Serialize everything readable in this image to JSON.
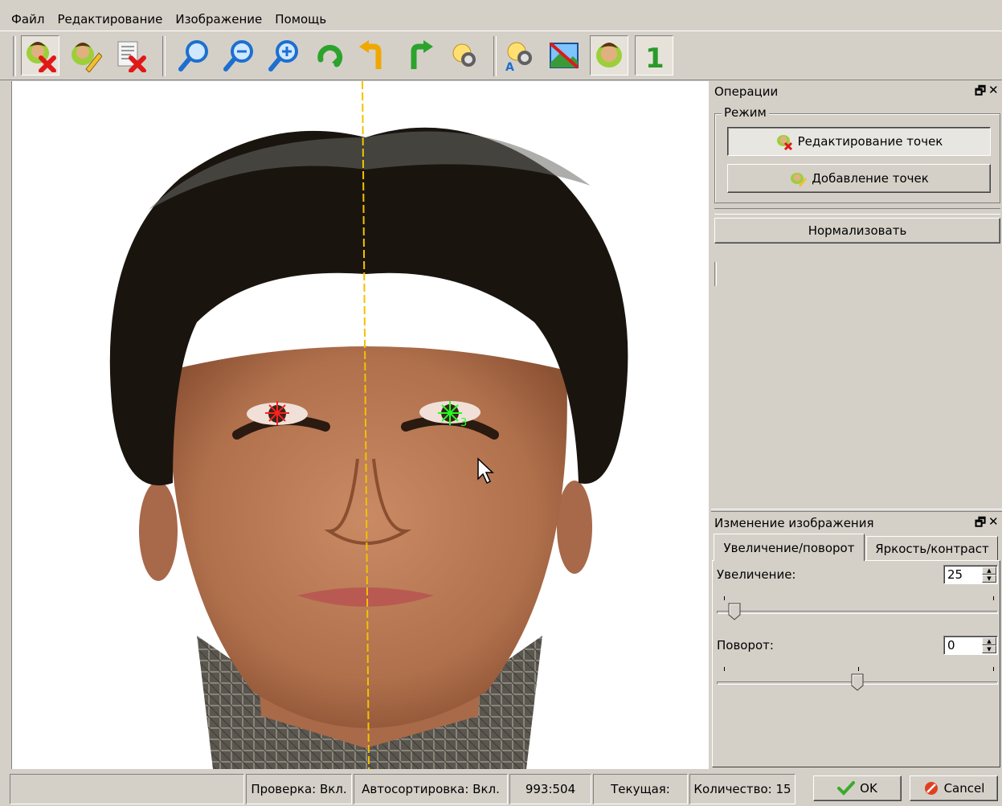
{
  "menu": [
    "Файл",
    "Редактирование",
    "Изображение",
    "Помощь"
  ],
  "toolbar": {
    "buttons": [
      {
        "icon": "delete-person-icon",
        "pressed": true
      },
      {
        "icon": "edit-person-icon",
        "pressed": false
      },
      {
        "icon": "delete-document-icon",
        "pressed": false
      },
      {
        "icon": "zoom-icon",
        "pressed": false
      },
      {
        "icon": "zoom-out-icon",
        "pressed": false
      },
      {
        "icon": "zoom-in-icon",
        "pressed": false
      },
      {
        "icon": "rotate-icon",
        "pressed": false
      },
      {
        "icon": "undo-icon",
        "pressed": false
      },
      {
        "icon": "redo-icon",
        "pressed": false
      },
      {
        "icon": "brightness-icon",
        "pressed": false
      },
      {
        "icon": "auto-brightness-icon",
        "pressed": false
      },
      {
        "icon": "hide-image-icon",
        "pressed": false
      },
      {
        "icon": "face-points-icon",
        "pressed": true
      },
      {
        "icon": "number-one-icon",
        "pressed": true
      }
    ]
  },
  "canvas": {
    "marker_right_label": "3",
    "symmetry_line_color": "#f2c200",
    "marker_left_color": "#ff2020",
    "marker_right_color": "#22ff22"
  },
  "operations_panel": {
    "title": "Операции",
    "mode_group_title": "Режим",
    "edit_points_label": "Редактирование точек",
    "add_points_label": "Добавление точек",
    "normalize_label": "Нормализовать"
  },
  "image_panel": {
    "title": "Изменение изображения",
    "tabs": [
      "Увеличение/поворот",
      "Яркость/контраст"
    ],
    "active_tab": 0,
    "zoom_label": "Увеличение:",
    "zoom_value": "25",
    "rotation_label": "Поворот:",
    "rotation_value": "0",
    "zoom_slider_fraction": 0.03,
    "rotation_slider_fraction": 0.5
  },
  "statusbar": {
    "check": "Проверка: Вкл.",
    "autosort": "Автосортировка: Вкл.",
    "coords": "993:504",
    "current": "Текущая:",
    "count": "Количество: 15",
    "ok_label": "OK",
    "cancel_label": "Cancel"
  }
}
